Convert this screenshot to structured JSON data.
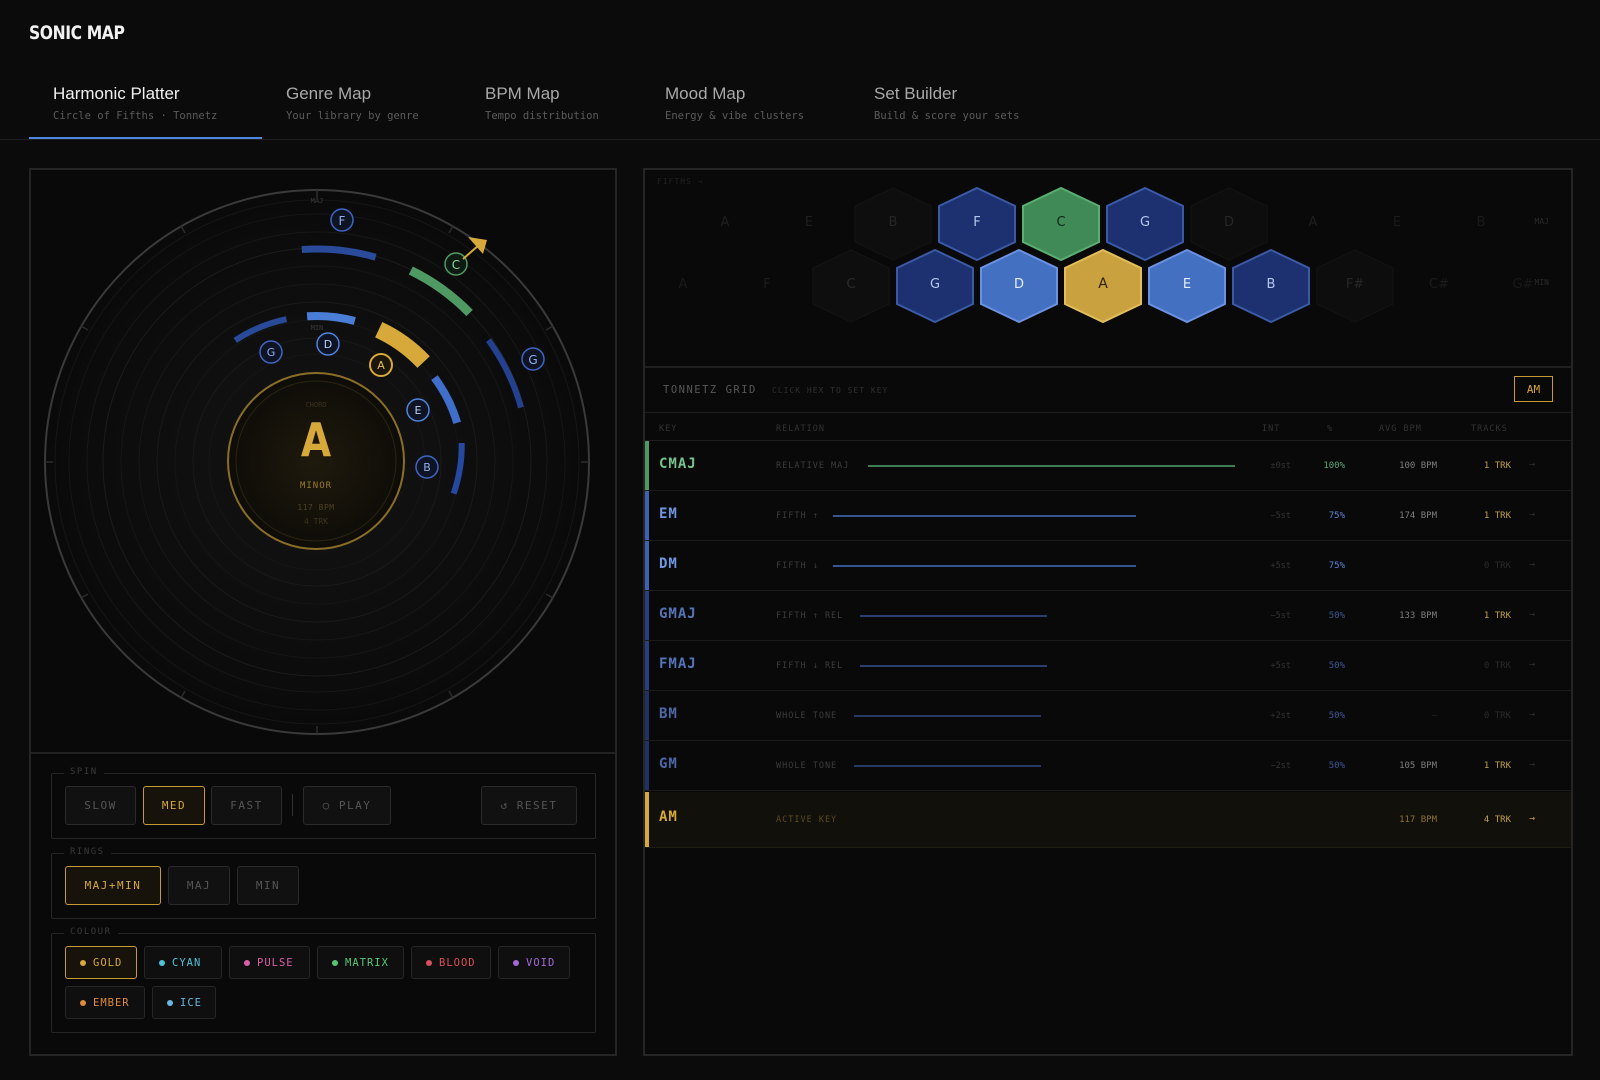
{
  "app": {
    "title": "SONIC MAP"
  },
  "tabs": [
    {
      "label": "Harmonic Platter",
      "sub": "Circle of Fifths · Tonnetz",
      "active": true
    },
    {
      "label": "Genre Map",
      "sub": "Your library by genre"
    },
    {
      "label": "BPM Map",
      "sub": "Tempo distribution"
    },
    {
      "label": "Mood Map",
      "sub": "Energy & vibe clusters"
    },
    {
      "label": "Set Builder",
      "sub": "Build & score your sets"
    }
  ],
  "platter": {
    "outer_label": "MAJ",
    "inner_label": "MIN",
    "major_nodes": [
      "F",
      "C",
      "G"
    ],
    "minor_nodes": [
      "G",
      "D",
      "A",
      "E",
      "B"
    ],
    "center": {
      "top": "CHORD",
      "key": "A",
      "mode": "MINOR",
      "bpm": "117 BPM",
      "tracks": "4 TRK"
    },
    "accent": "#d6a93a"
  },
  "controls": {
    "spin": {
      "label": "SPIN",
      "slow": "SLOW",
      "med": "MED",
      "fast": "FAST",
      "play": "○ PLAY",
      "reset": "↺ RESET",
      "active": "MED"
    },
    "rings": {
      "label": "RINGS",
      "both": "MAJ+MIN",
      "maj": "MAJ",
      "min": "MIN",
      "active": "MAJ+MIN"
    },
    "colour": {
      "label": "COLOUR",
      "active": "GOLD",
      "options": [
        {
          "name": "GOLD",
          "color": "#d6a93a"
        },
        {
          "name": "CYAN",
          "color": "#4fc3d9"
        },
        {
          "name": "PULSE",
          "color": "#d95fa8"
        },
        {
          "name": "MATRIX",
          "color": "#57c776"
        },
        {
          "name": "BLOOD",
          "color": "#d9505a"
        },
        {
          "name": "VOID",
          "color": "#a368d9"
        },
        {
          "name": "EMBER",
          "color": "#e08a3c"
        },
        {
          "name": "ICE",
          "color": "#6ab7e0"
        }
      ]
    }
  },
  "tonnetz": {
    "corner_label": "FIFTHS →",
    "maj_label": "MAJ",
    "min_label": "MIN",
    "top_row": [
      "A",
      "E",
      "B",
      "F",
      "C",
      "G",
      "D",
      "A",
      "E",
      "B"
    ],
    "bottom_row": [
      "A",
      "F",
      "C",
      "G",
      "D",
      "A",
      "E",
      "B",
      "F#",
      "C#",
      "G#"
    ],
    "title": "TONNETZ GRID",
    "hint": "CLICK HEX TO SET KEY",
    "current_key": "AM"
  },
  "table": {
    "headers": {
      "key": "KEY",
      "relation": "RELATION",
      "int": "INT",
      "pct": "%",
      "avg_bpm": "AVG BPM",
      "tracks": "TRACKS"
    },
    "rows": [
      {
        "key": "CMAJ",
        "relation": "RELATIVE MAJ",
        "int": "±0st",
        "pct": "100%",
        "bpm": "100 BPM",
        "tracks": "1 TRK",
        "go": "→",
        "fill": 1.0,
        "color": "#5fa878"
      },
      {
        "key": "EM",
        "relation": "FIFTH ↑",
        "int": "−5st",
        "pct": "75%",
        "bpm": "174 BPM",
        "tracks": "1 TRK",
        "go": "→",
        "fill": 0.75,
        "color": "#5b86d6"
      },
      {
        "key": "DM",
        "relation": "FIFTH ↓",
        "int": "+5st",
        "pct": "75%",
        "bpm": "",
        "tracks": "0 TRK",
        "go": "→",
        "fill": 0.75,
        "color": "#5b86d6"
      },
      {
        "key": "GMAJ",
        "relation": "FIFTH ↑ REL",
        "int": "−5st",
        "pct": "50%",
        "bpm": "133 BPM",
        "tracks": "1 TRK",
        "go": "→",
        "fill": 0.5,
        "color": "#4a66a8"
      },
      {
        "key": "FMAJ",
        "relation": "FIFTH ↓ REL",
        "int": "+5st",
        "pct": "50%",
        "bpm": "",
        "tracks": "0 TRK",
        "go": "→",
        "fill": 0.5,
        "color": "#4a66a8"
      },
      {
        "key": "BM",
        "relation": "WHOLE TONE",
        "int": "+2st",
        "pct": "50%",
        "bpm": "—",
        "tracks": "0 TRK",
        "go": "→",
        "fill": 0.5,
        "color": "#4a66a8"
      },
      {
        "key": "GM",
        "relation": "WHOLE TONE",
        "int": "−2st",
        "pct": "50%",
        "bpm": "105 BPM",
        "tracks": "1 TRK",
        "go": "→",
        "fill": 0.5,
        "color": "#4a66a8"
      }
    ],
    "active_row": {
      "key": "AM",
      "relation": "ACTIVE KEY",
      "bpm": "117 BPM",
      "tracks": "4 TRK",
      "go": "→",
      "color": "#d6a93a"
    }
  }
}
